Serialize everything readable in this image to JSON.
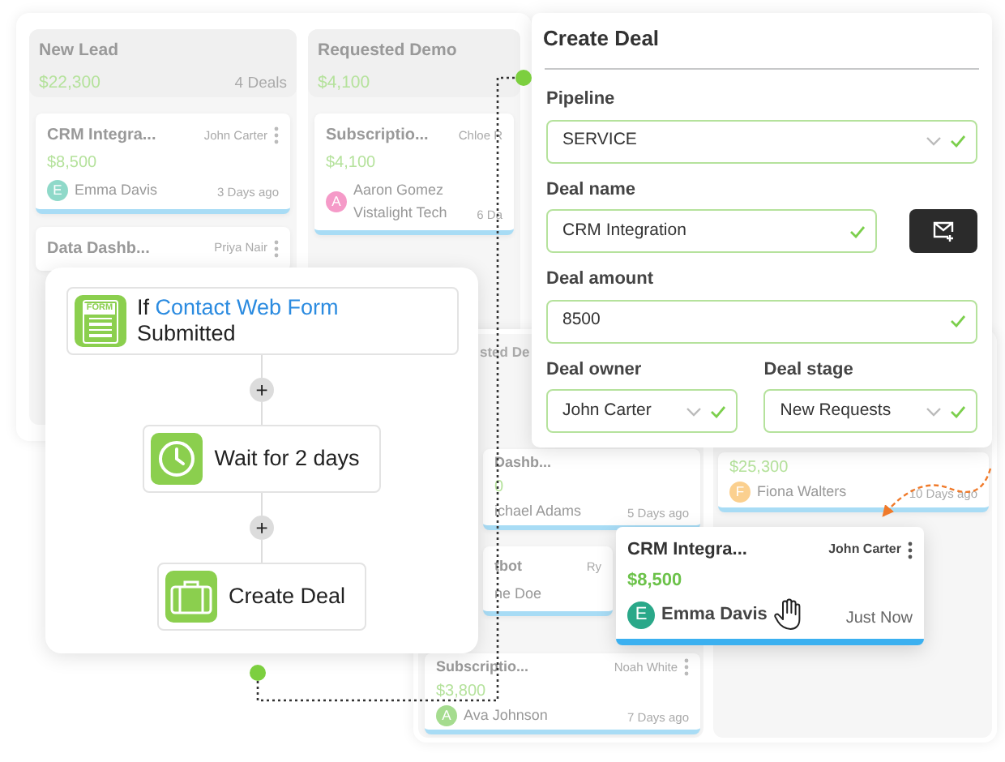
{
  "board": {
    "columns": [
      {
        "title": "New Lead",
        "total": "$22,300",
        "count": "4 Deals",
        "cards": [
          {
            "title": "CRM Integra...",
            "owner": "John Carter",
            "menu": true,
            "amount": "$8,500",
            "avatar": "E",
            "color": "#8fd9c9",
            "contact": "Emma Davis",
            "time": "3 Days ago"
          },
          {
            "title": "Data Dashb...",
            "owner": "Priya Nair",
            "menu": true
          }
        ]
      },
      {
        "title": "Requested Demo",
        "total": "$4,100",
        "cards": [
          {
            "title": "Subscriptio...",
            "owner": "Chloe R",
            "menu": false,
            "amount": "$4,100",
            "avatar": "A",
            "color": "#f59ac8",
            "contact": "Aaron Gomez",
            "company": "Vistalight Tech",
            "time": "6 Da"
          }
        ]
      }
    ]
  },
  "board_behind": {
    "columns": [
      {
        "title": "sted De",
        "cards": [
          {
            "title": "Dashb...",
            "menu": false,
            "amount": "0",
            "contact": "ichael Adams",
            "time": "5 Days ago"
          },
          {
            "title": "tbot",
            "owner": "Ry",
            "menu": false,
            "contact": "ne Doe"
          },
          {
            "title": "Subscriptio...",
            "owner": "Noah White",
            "menu": true,
            "amount": "$3,800",
            "avatar": "A",
            "color": "#a5dc8f",
            "contact": "Ava Johnson",
            "time": "7 Days ago"
          }
        ]
      },
      {
        "cards": [
          {
            "menu": false,
            "amount": "$25,300",
            "avatar": "F",
            "color": "#fbd08f",
            "contact": "Fiona Walters",
            "time": "10 Days ago"
          }
        ]
      }
    ]
  },
  "workflow": {
    "steps": [
      {
        "kind": "trigger",
        "icon_label": "FORM",
        "prefix": "If",
        "link": "Contact Web Form",
        "suffix": "Submitted"
      },
      {
        "kind": "wait",
        "text": "Wait for 2 days"
      },
      {
        "kind": "action",
        "text": "Create Deal"
      }
    ],
    "add_buttons": [
      "+",
      "+"
    ]
  },
  "create_deal": {
    "title": "Create Deal",
    "rows": [
      [
        {
          "kind": "select",
          "label": "Pipeline",
          "value": "SERVICE",
          "valid": true
        }
      ],
      [
        {
          "kind": "text_with_button",
          "label": "Deal name",
          "value": "CRM Integration",
          "valid": true
        }
      ],
      [
        {
          "kind": "text",
          "label": "Deal amount",
          "value": "8500",
          "valid": true
        }
      ],
      [
        {
          "kind": "select",
          "label": "Deal owner",
          "value": "John Carter",
          "valid": true
        },
        {
          "kind": "select",
          "label": "Deal stage",
          "value": "New Requests",
          "valid": true
        }
      ]
    ]
  },
  "dragged_card": {
    "title": "CRM Integra...",
    "owner": "John Carter",
    "menu": true,
    "amount": "$8,500",
    "avatar": "E",
    "color": "#2aa889",
    "contact": "Emma Davis",
    "time": "Just Now"
  }
}
